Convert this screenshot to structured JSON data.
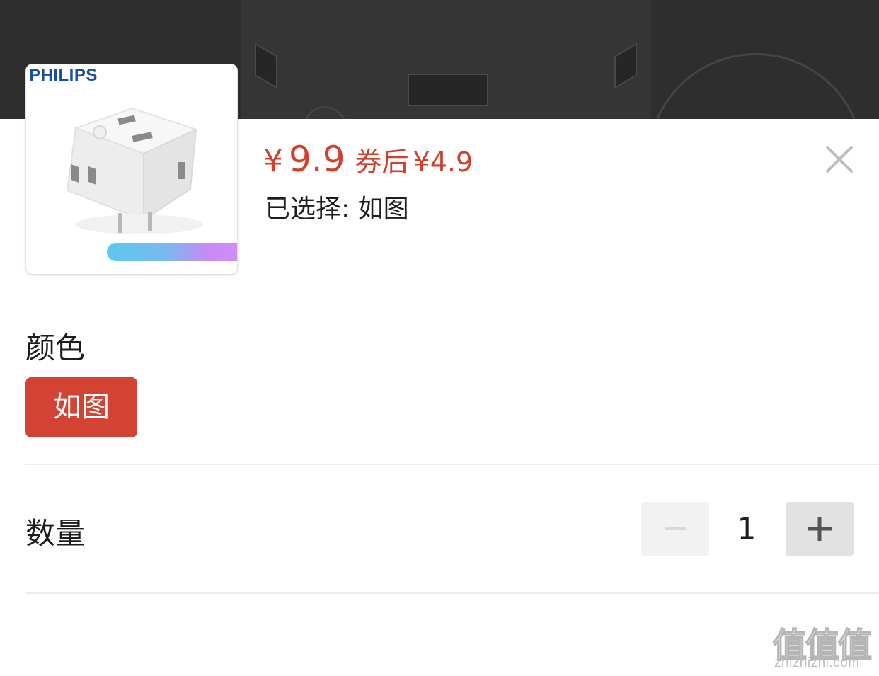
{
  "product": {
    "brand": "PHILIPS",
    "image_icon": "power-socket-adapter",
    "price_symbol": "¥",
    "price": "9.9",
    "coupon_label": "券后",
    "coupon_price": "¥4.9",
    "selected_text": "已选择: 如图"
  },
  "colors": {
    "accent_red": "#d34232",
    "price_red": "#d0402d",
    "brand_blue": "#1a4da8"
  },
  "spec": {
    "color_label": "颜色",
    "options": [
      "如图"
    ],
    "selected_option": "如图"
  },
  "quantity": {
    "label": "数量",
    "value": "1",
    "minus_icon": "minus-icon",
    "plus_icon": "plus-icon"
  },
  "watermark": {
    "glyphs": "值值值",
    "url": "zhizhizhi.com"
  }
}
